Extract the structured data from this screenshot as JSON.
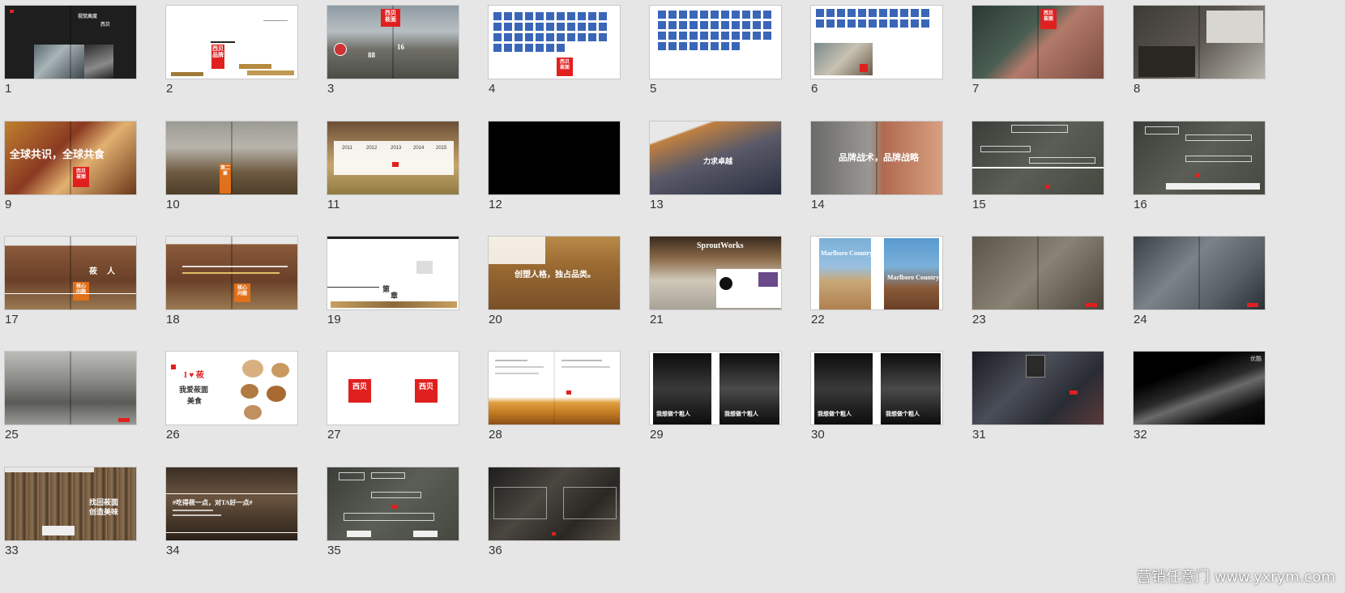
{
  "slides": [
    {
      "num": "1",
      "texts": [
        "视觉高度",
        "西贝"
      ]
    },
    {
      "num": "2",
      "texts": [
        "西贝",
        "品牌"
      ]
    },
    {
      "num": "3",
      "texts": [
        "西贝",
        "莜面",
        "88",
        "16"
      ]
    },
    {
      "num": "4",
      "texts": [
        "西贝",
        "莜面"
      ]
    },
    {
      "num": "5",
      "texts": []
    },
    {
      "num": "6",
      "texts": []
    },
    {
      "num": "7",
      "texts": [
        "西贝",
        "莜面"
      ]
    },
    {
      "num": "8",
      "texts": []
    },
    {
      "num": "9",
      "texts": [
        "全球共识，全球共食",
        "西贝",
        "莜面"
      ]
    },
    {
      "num": "10",
      "texts": [
        "第二章"
      ]
    },
    {
      "num": "11",
      "texts": [
        "2011",
        "2012",
        "2013",
        "2014",
        "2015"
      ]
    },
    {
      "num": "12",
      "texts": []
    },
    {
      "num": "13",
      "texts": [
        "力求卓越"
      ]
    },
    {
      "num": "14",
      "texts": [
        "品牌战术，品牌战略"
      ]
    },
    {
      "num": "15",
      "texts": []
    },
    {
      "num": "16",
      "texts": []
    },
    {
      "num": "17",
      "texts": [
        "莜",
        "人",
        "核心",
        "问题"
      ]
    },
    {
      "num": "18",
      "texts": [
        "核心",
        "问题"
      ]
    },
    {
      "num": "19",
      "texts": [
        "第",
        "章"
      ]
    },
    {
      "num": "20",
      "texts": [
        "创塑人格，独占品类。"
      ]
    },
    {
      "num": "21",
      "texts": [
        "SproutWorks"
      ]
    },
    {
      "num": "22",
      "texts": [
        "Marlboro Country.",
        "Marlboro Country."
      ]
    },
    {
      "num": "23",
      "texts": []
    },
    {
      "num": "24",
      "texts": []
    },
    {
      "num": "25",
      "texts": []
    },
    {
      "num": "26",
      "texts": [
        "I ♥ 莜",
        "我爱莜面",
        "美食"
      ]
    },
    {
      "num": "27",
      "texts": [
        "西贝",
        "西贝"
      ]
    },
    {
      "num": "28",
      "texts": []
    },
    {
      "num": "29",
      "texts": [
        "我想做个粗人",
        "我想做个粗人"
      ]
    },
    {
      "num": "30",
      "texts": [
        "我想做个粗人",
        "我想做个粗人"
      ]
    },
    {
      "num": "31",
      "texts": []
    },
    {
      "num": "32",
      "texts": [
        "优酷"
      ]
    },
    {
      "num": "33",
      "texts": [
        "找回莜面",
        "创造美味"
      ]
    },
    {
      "num": "34",
      "texts": [
        "#吃得莜一点，对TA好一点#"
      ]
    },
    {
      "num": "35",
      "texts": []
    },
    {
      "num": "36",
      "texts": []
    }
  ],
  "watermark": "营销任意门 www.yxrym.com",
  "colors": {
    "background": "#e6e6e6",
    "brand_red": "#e0201f",
    "frame": "#c8c8c8"
  }
}
